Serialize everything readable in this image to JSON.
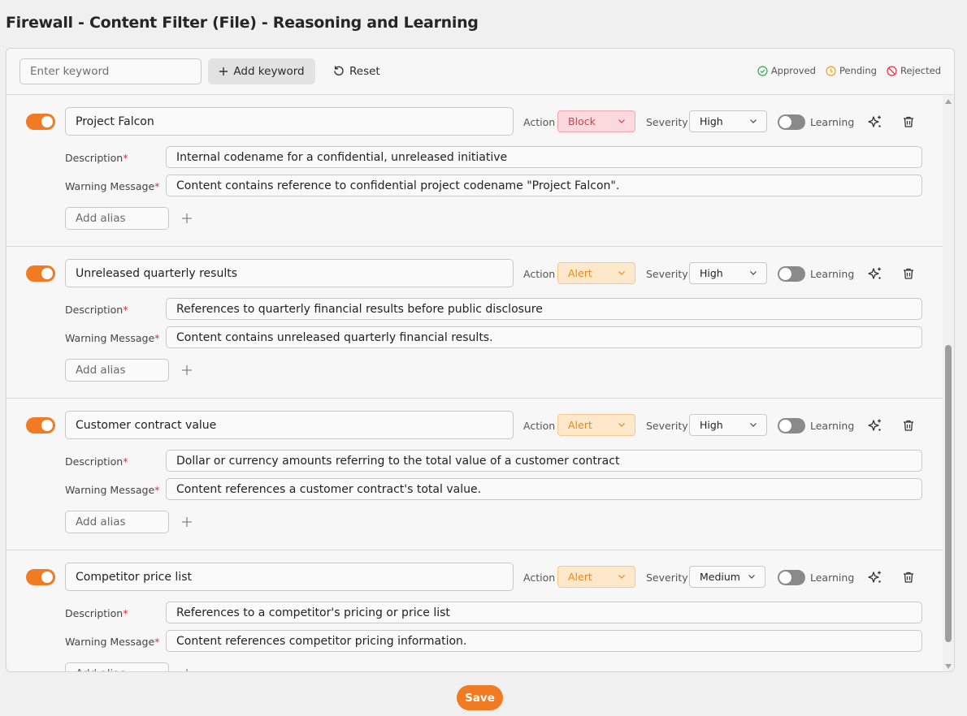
{
  "page": {
    "title": "Firewall - Content Filter (File) - Reasoning and Learning"
  },
  "toolbar": {
    "keyword_placeholder": "Enter keyword",
    "add_keyword_label": "Add keyword",
    "reset_label": "Reset",
    "legend": {
      "approved": "Approved",
      "pending": "Pending",
      "rejected": "Rejected"
    }
  },
  "labels": {
    "action": "Action",
    "severity": "Severity",
    "learning": "Learning",
    "description": "Description",
    "warning_message": "Warning Message",
    "required_mark": "*",
    "add_alias_placeholder": "Add alias"
  },
  "colors": {
    "accent": "#f07b22",
    "block": "#d93a48",
    "alert": "#e68a19",
    "approved": "#2fa84f",
    "pending": "#f0a01e",
    "rejected": "#e0333f"
  },
  "rules": [
    {
      "enabled": true,
      "name": "Project Falcon",
      "action": "Block",
      "severity": "High",
      "learning": false,
      "description": "Internal codename for a confidential, unreleased initiative",
      "warning": "Content contains reference to confidential project codename \"Project Falcon\"."
    },
    {
      "enabled": true,
      "name": "Unreleased quarterly results",
      "action": "Alert",
      "severity": "High",
      "learning": false,
      "description": "References to quarterly financial results before public disclosure",
      "warning": "Content contains unreleased quarterly financial results."
    },
    {
      "enabled": true,
      "name": "Customer contract value",
      "action": "Alert",
      "severity": "High",
      "learning": false,
      "description": "Dollar or currency amounts referring to the total value of a customer contract",
      "warning": "Content references a customer contract's total value."
    },
    {
      "enabled": true,
      "name": "Competitor price list",
      "action": "Alert",
      "severity": "Medium",
      "learning": false,
      "description": "References to a competitor's pricing or price list",
      "warning": "Content references competitor pricing information."
    }
  ],
  "footer": {
    "save_label": "Save"
  }
}
